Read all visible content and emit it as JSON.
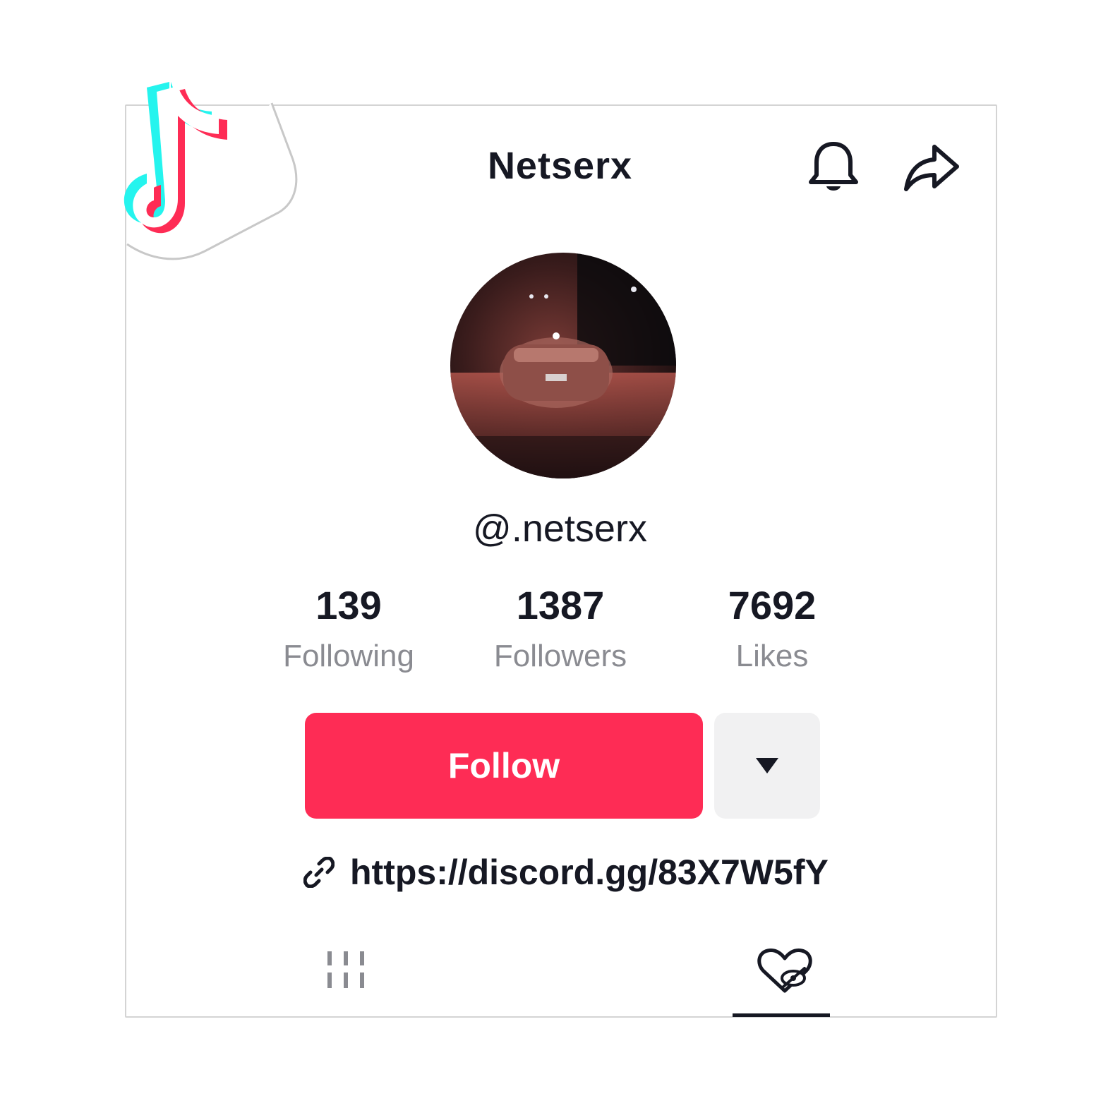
{
  "header": {
    "title": "Netserx",
    "bell_icon": "bell-icon",
    "share_icon": "share-arrow-icon"
  },
  "profile": {
    "handle": "@.netserx",
    "avatar_description": "avatar"
  },
  "stats": [
    {
      "value": "139",
      "label": "Following"
    },
    {
      "value": "1387",
      "label": "Followers"
    },
    {
      "value": "7692",
      "label": "Likes"
    }
  ],
  "actions": {
    "follow_label": "Follow",
    "more_icon": "caret-down-icon"
  },
  "bio": {
    "link_icon": "link-icon",
    "link": "https://discord.gg/83X7W5fY"
  },
  "tabs": [
    {
      "icon": "grid-videos-icon",
      "active": false
    },
    {
      "icon": "liked-hidden-icon",
      "active": true
    }
  ],
  "colors": {
    "accent": "#fe2c55",
    "text": "#161823",
    "muted": "#8a8b91",
    "button_secondary": "#f1f1f2",
    "logo_cyan": "#25f4ee",
    "logo_red": "#fe2c55"
  }
}
